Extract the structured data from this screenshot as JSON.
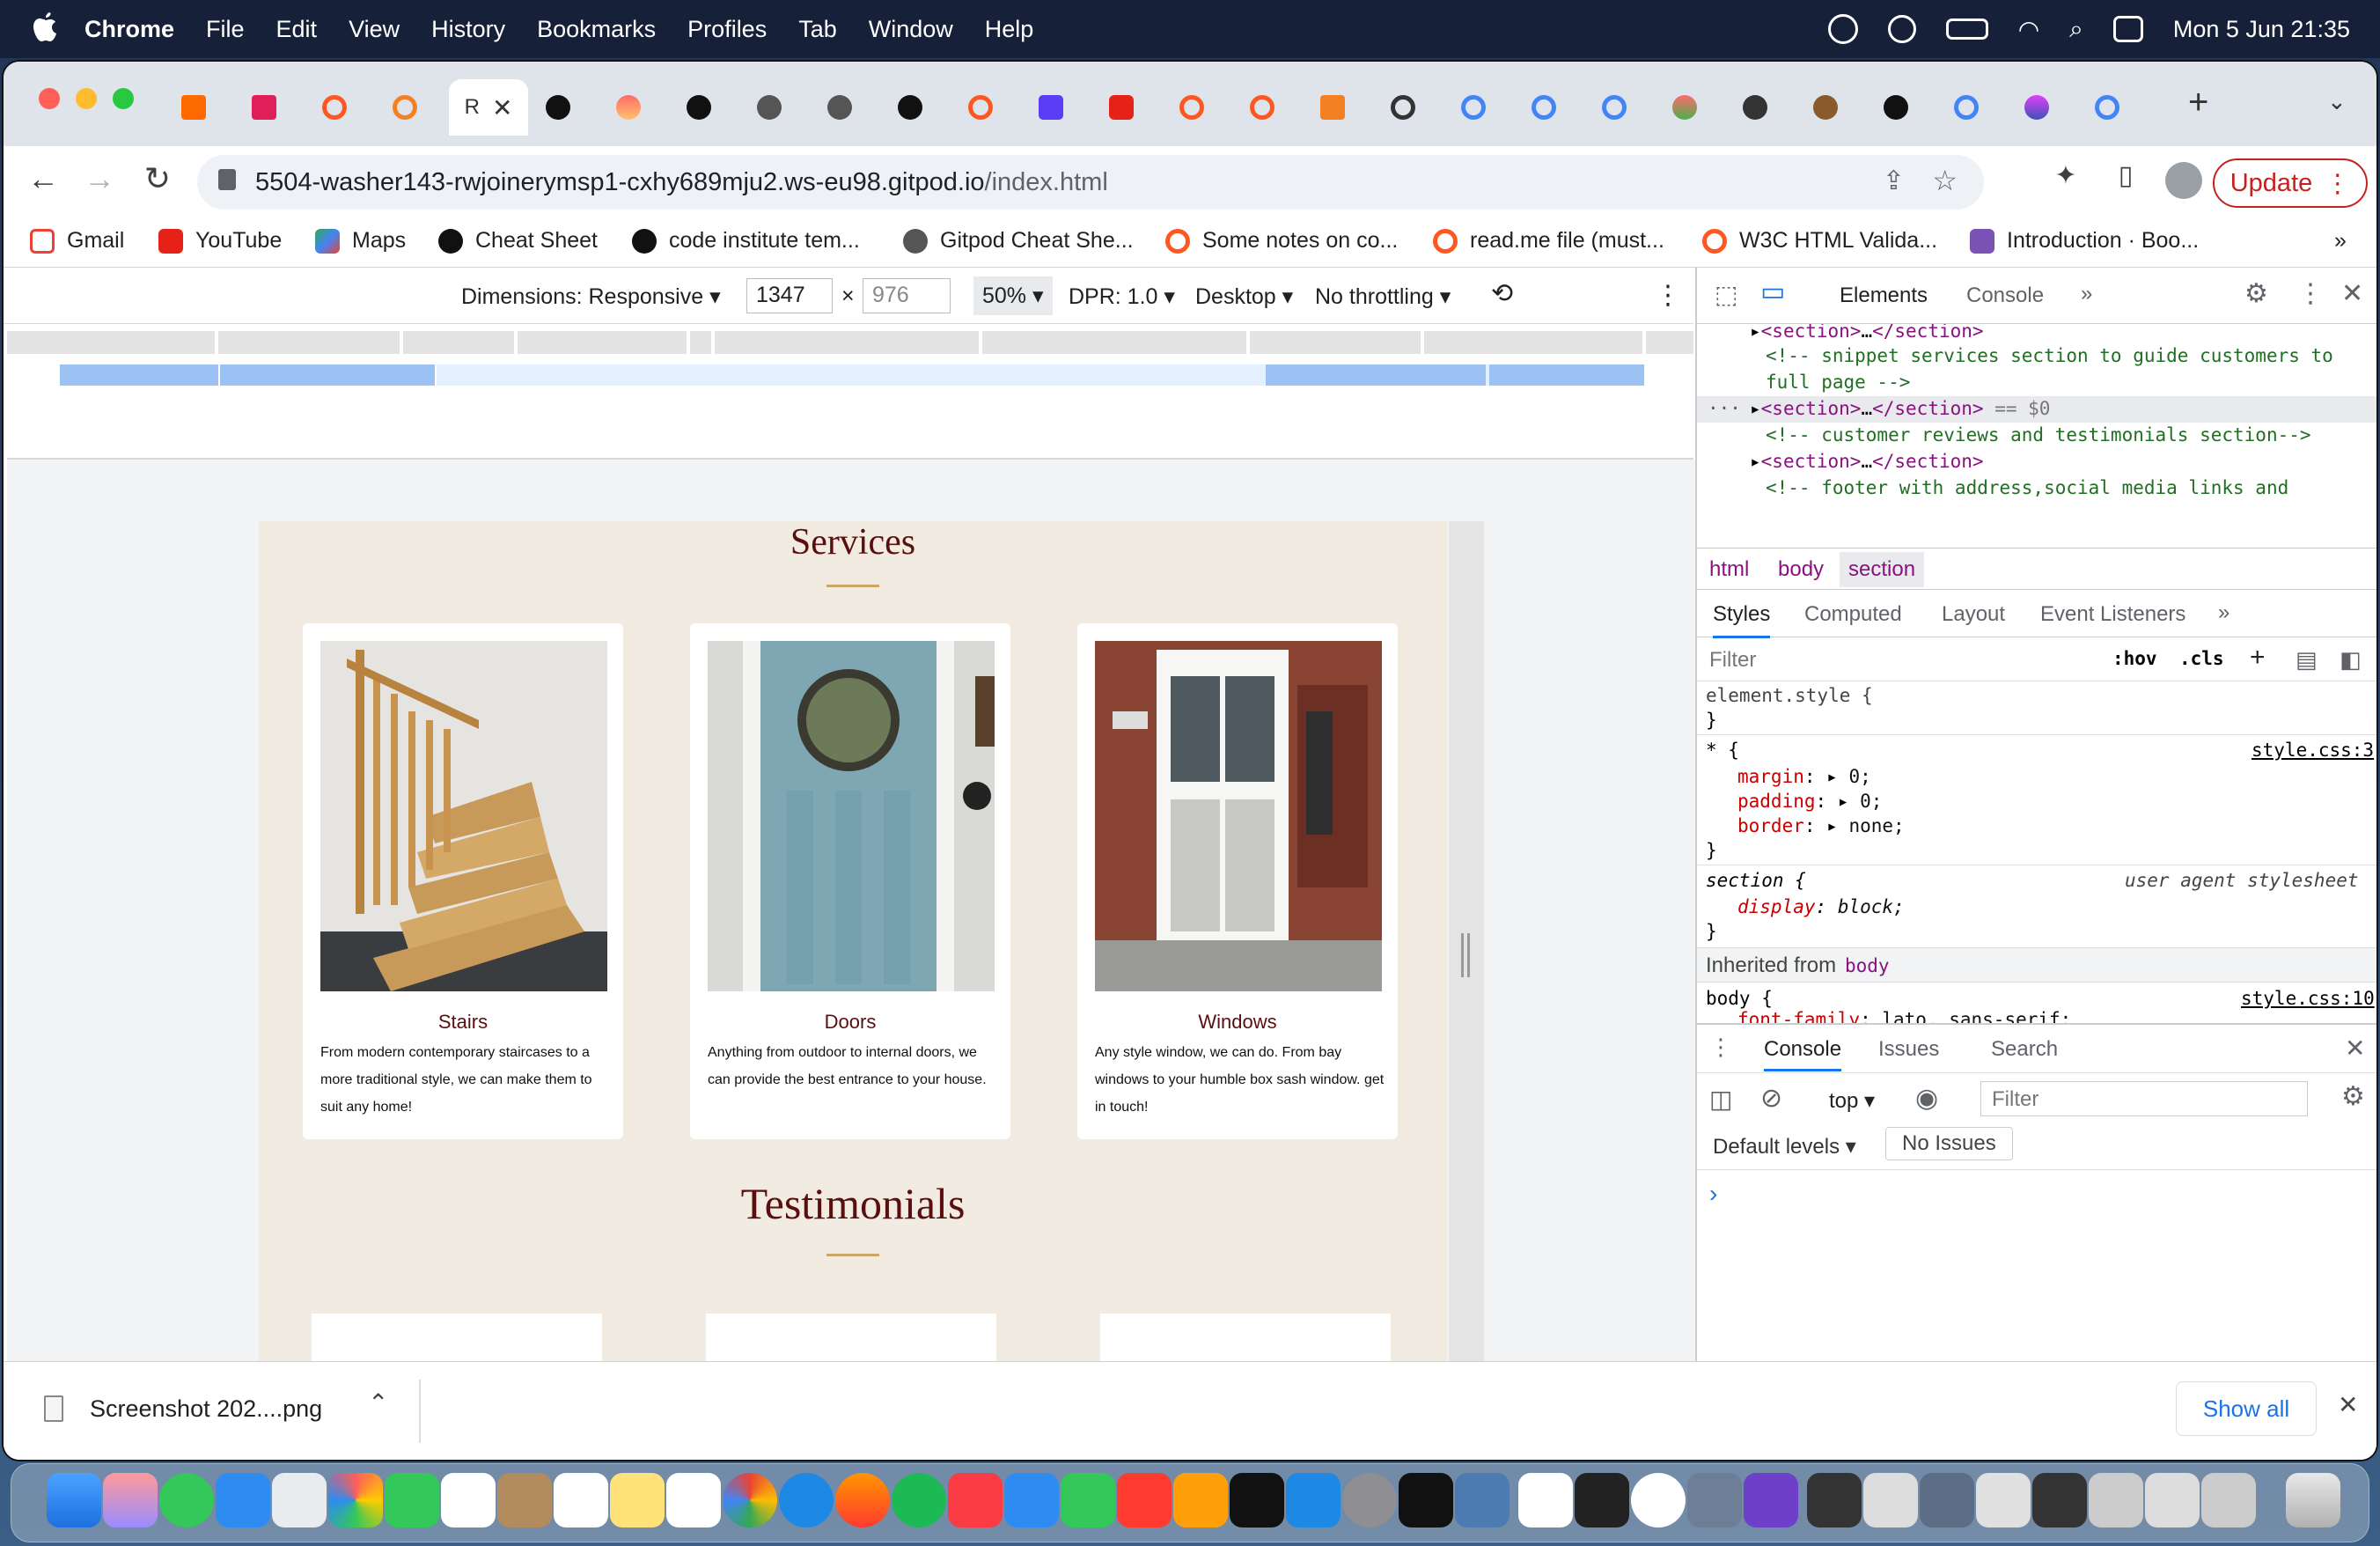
{
  "menubar": {
    "app": "Chrome",
    "items": [
      "File",
      "Edit",
      "View",
      "History",
      "Bookmarks",
      "Profiles",
      "Tab",
      "Window",
      "Help"
    ],
    "datetime": "Mon 5 Jun  21:35"
  },
  "browser": {
    "active_tab_label": "R",
    "url_host": "5504-washer143-rwjoinerymsp1-cxhy689mju2.ws-eu98.gitpod.io",
    "url_path": "/index.html",
    "update_label": "Update",
    "bookmarks": [
      "Gmail",
      "YouTube",
      "Maps",
      "Cheat Sheet",
      "code institute tem...",
      "Gitpod Cheat She...",
      "Some notes on co...",
      "read.me file (must...",
      "W3C HTML Valida...",
      "Introduction · Boo..."
    ],
    "bookmarks_more": "»"
  },
  "device_toolbar": {
    "dimensions_label": "Dimensions: Responsive",
    "width": "1347",
    "height": "976",
    "times": "×",
    "zoom": "50%",
    "dpr": "DPR: 1.0",
    "device": "Desktop",
    "throttling": "No throttling"
  },
  "site": {
    "services_title": "Services",
    "cards": [
      {
        "title": "Stairs",
        "desc": "From modern contemporary staircases to a more traditional style, we can make them to suit any home!"
      },
      {
        "title": "Doors",
        "desc": "Anything from outdoor to internal doors, we can provide the best entrance to your house."
      },
      {
        "title": "Windows",
        "desc": "Any style window, we can do. From bay windows to your humble box sash window. get in touch!"
      }
    ],
    "testimonials_title": "Testimonials"
  },
  "devtools": {
    "tabs": [
      "Elements",
      "Console"
    ],
    "more": "»",
    "dom": {
      "section_open": "<section>",
      "ellipsis": "…",
      "section_close": "</section>",
      "comment_services_1": "<!-- snippet services section to guide customers to",
      "comment_services_2": "full page -->",
      "selected_marker": "== $0",
      "comment_reviews": "<!-- customer reviews and testimonials section-->",
      "comment_footer": "<!-- footer with address,social media links and"
    },
    "breadcrumb": [
      "html",
      "body",
      "section"
    ],
    "style_tabs": [
      "Styles",
      "Computed",
      "Layout",
      "Event Listeners"
    ],
    "filter_placeholder": "Filter",
    "hov": ":hov",
    "cls": ".cls",
    "rules": {
      "element_style": "element.style {",
      "close": "}",
      "star_selector": "* {",
      "star_source": "style.css:3",
      "margin": "margin",
      "margin_val": "0;",
      "padding": "padding",
      "padding_val": "0;",
      "border": "border",
      "border_val": "none;",
      "section_selector": "section {",
      "section_source": "user agent stylesheet",
      "display": "display",
      "display_val": "block;",
      "inherited": "Inherited from",
      "inherited_el": "body",
      "body_selector": "body {",
      "body_source": "style.css:10",
      "font_family": "font-family",
      "font_family_val": "lato, sans-serif;"
    },
    "drawer_tabs": [
      "Console",
      "Issues",
      "Search"
    ],
    "context": "top",
    "console_filter": "Filter",
    "levels": "Default levels",
    "no_issues": "No Issues",
    "prompt": "›"
  },
  "download": {
    "file": "Screenshot 202....png",
    "show_all": "Show all"
  },
  "colors": {
    "accent_red": "#5a0f0f",
    "update_red": "#c5221f",
    "site_bg": "#f1ebe2"
  }
}
